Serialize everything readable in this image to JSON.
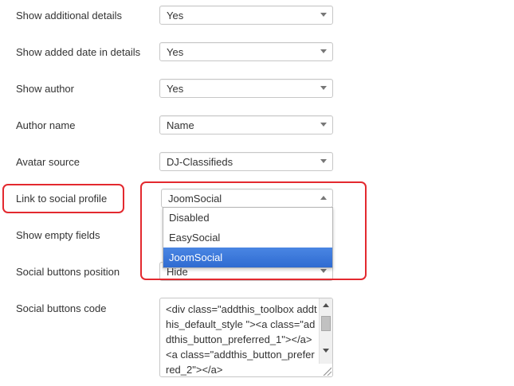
{
  "fields": [
    {
      "label": "Show additional details",
      "value": "Yes"
    },
    {
      "label": "Show added date in details",
      "value": "Yes"
    },
    {
      "label": "Show author",
      "value": "Yes"
    },
    {
      "label": "Author name",
      "value": "Name"
    },
    {
      "label": "Avatar source",
      "value": "DJ-Classifieds"
    },
    {
      "label": "Link to social profile",
      "value": "JoomSocial"
    },
    {
      "label": "Show empty fields",
      "value": ""
    },
    {
      "label": "Social buttons position",
      "value": "Hide"
    },
    {
      "label": "Social buttons code",
      "value": "<div class=\"addthis_toolbox addthis_default_style \"><a class=\"addthis_button_preferred_1\"></a><a class=\"addthis_button_preferred_2\"></a>"
    }
  ],
  "dropdown": {
    "options": [
      "Disabled",
      "EasySocial",
      "JoomSocial"
    ],
    "selected": "JoomSocial"
  },
  "colors": {
    "highlight": "#e3292f",
    "selected_option": "#3875d7"
  }
}
